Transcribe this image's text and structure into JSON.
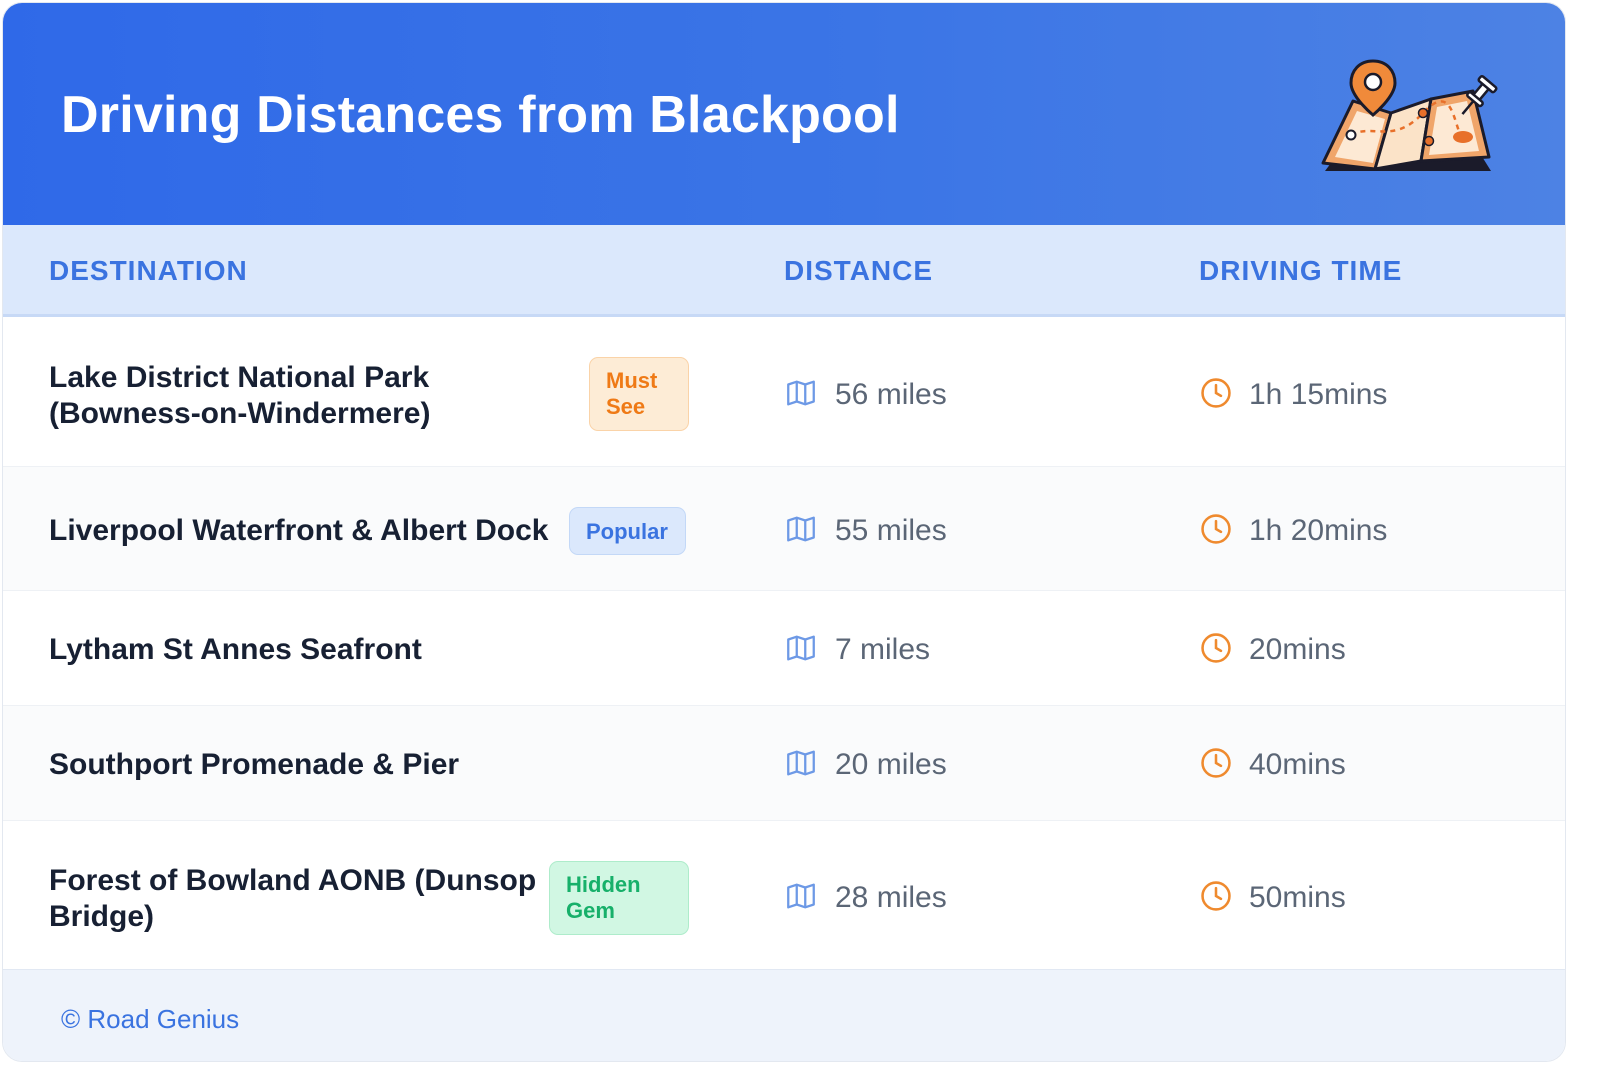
{
  "header": {
    "title": "Driving Distances from Blackpool",
    "illustration_icon": "map-with-pins-icon"
  },
  "columns": {
    "destination": "DESTINATION",
    "distance": "DISTANCE",
    "driving_time": "DRIVING TIME"
  },
  "rows": [
    {
      "destination_line1": "Lake District National Park",
      "destination_line2": "(Bowness-on-Windermere)",
      "badge_line1": "Must",
      "badge_line2": "See",
      "badge_color": "#ef7a16",
      "distance": "56 miles",
      "time": "1h 15mins"
    },
    {
      "destination_line1": "Liverpool Waterfront & Albert Dock",
      "badge_line1": "Popular",
      "badge_color": "#3a73e0",
      "distance": "55 miles",
      "time": "1h 20mins"
    },
    {
      "destination_line1": "Lytham St Annes Seafront",
      "distance": "7 miles",
      "time": "20mins"
    },
    {
      "destination_line1": "Southport Promenade & Pier",
      "distance": "20 miles",
      "time": "40mins"
    },
    {
      "destination_line1": "Forest of Bowland AONB (Dunsop",
      "destination_line2": "Bridge)",
      "badge_line1": "Hidden",
      "badge_line2": "Gem",
      "badge_color": "#17b06a",
      "distance": "28 miles",
      "time": "50mins"
    }
  ],
  "icons": {
    "distance": "map-icon",
    "time": "clock-icon"
  },
  "colors": {
    "header_blue": "#2f69e8",
    "accent_blue": "#3a73e0",
    "clock_orange": "#ef8a2e",
    "text_dark": "#172033",
    "text_muted": "#5b6676"
  },
  "footer": {
    "brand": "© Road Genius"
  }
}
